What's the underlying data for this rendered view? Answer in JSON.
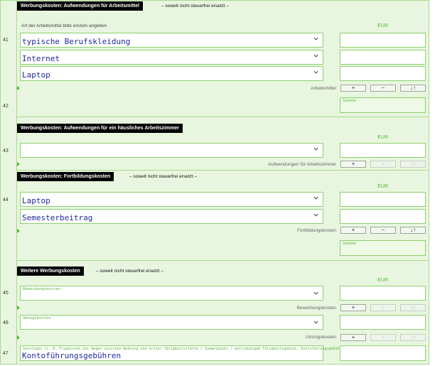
{
  "sections": {
    "arbeitsmittel": {
      "title": "Werbungskosten: Aufwendungen für Arbeitsmittel",
      "note": "– soweit nicht steuerfrei ersetzt –"
    },
    "arbeitszimmer": {
      "title": "Werbungskosten: Aufwendungen für ein häusliches Arbeitszimmer"
    },
    "fortbildung": {
      "title": "Werbungskosten: Fortbildungskosten",
      "note": "– soweit nicht steuerfrei ersetzt –"
    },
    "weitere": {
      "title": "Weitere Werbungskosten",
      "note": "– soweit nicht steuerfrei ersetzt –"
    }
  },
  "labels": {
    "art_arbeitsmittel": "Art der Arbeitsmittel bitte einzeln angeben",
    "eur": "EUR",
    "summe": "Summe",
    "ctl_arbeitsmittel": "Arbeitsmittel",
    "ctl_arbeitszimmer": "Aufwendungen für Arbeitszimmer",
    "ctl_fortbildung": "Fortbildungskosten",
    "ctl_bewerbung": "Bewerbungskosten",
    "ctl_umzug": "Umzugskosten",
    "in_bewerbung": "Bewerbungskosten",
    "in_umzug": "Umzugskosten",
    "in_sonstiges": "Sonstiges (z. B. Flugkosten bei Wegen zwischen Wohnung und erster Tätigkeitsstätte / Sammelpunkt / weiträumigem Tätigkeitsgebiet, Kontoführungsgebühren)"
  },
  "buttons": {
    "plus": "+",
    "minus": "−",
    "sort": "↓↑"
  },
  "rows": {
    "r41": "41",
    "r42": "42",
    "r43": "43",
    "r44": "44",
    "r45": "45",
    "r46": "46",
    "r47": "47"
  },
  "fields": {
    "arbeitsmittel": [
      "typische Berufskleidung",
      "Internet",
      "Laptop"
    ],
    "arbeitszimmer": "",
    "fortbildung": [
      "Laptop",
      "Semesterbeitrag"
    ],
    "bewerbung": "",
    "umzug": "",
    "sonstiges": "Kontoführungsgebühren"
  },
  "colors": {
    "accent": "#58b53a",
    "border": "#a7d98f",
    "background": "#e9f6df",
    "value_text": "#1f2a9c"
  },
  "icons": {
    "dropdown": "chevron-down-icon",
    "row_marker": "triangle-right-icon"
  }
}
